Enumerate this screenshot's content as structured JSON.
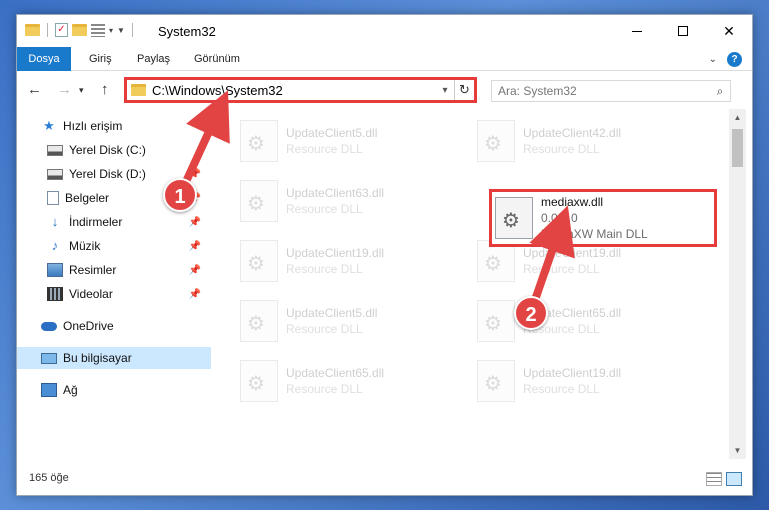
{
  "window": {
    "title": "System32",
    "minimize_icon": "minimize-icon",
    "maximize_icon": "maximize-icon",
    "close_symbol": "✕"
  },
  "ribbon": {
    "tabs": [
      "Dosya",
      "Giriş",
      "Paylaş",
      "Görünüm"
    ],
    "help_symbol": "?",
    "expand_symbol": "⌄"
  },
  "address": {
    "path": "C:\\Windows\\System32",
    "search_placeholder": "Ara: System32"
  },
  "nav": {
    "quick_access": "Hızlı erişim",
    "items": [
      {
        "label": "Yerel Disk (C:)",
        "pinned": true
      },
      {
        "label": "Yerel Disk (D:)",
        "pinned": true
      },
      {
        "label": "Belgeler",
        "pinned": true
      },
      {
        "label": "İndirmeler",
        "pinned": true
      },
      {
        "label": "Müzik",
        "pinned": true
      },
      {
        "label": "Resimler",
        "pinned": true
      },
      {
        "label": "Videolar",
        "pinned": true
      }
    ],
    "onedrive": "OneDrive",
    "this_pc": "Bu bilgisayar",
    "network": "Ağ"
  },
  "files": {
    "left_column": [
      {
        "name": "UpdateClient5.dll",
        "type": "Resource DLL"
      },
      {
        "name": "UpdateClient63.dll",
        "type": "Resource DLL"
      },
      {
        "name": "UpdateClient19.dll",
        "type": "Resource DLL"
      },
      {
        "name": "UpdateClient5.dll",
        "type": "Resource DLL"
      },
      {
        "name": "UpdateClient65.dll",
        "type": "Resource DLL"
      }
    ],
    "right_column": [
      {
        "name": "UpdateClient42.dll",
        "type": "Resource DLL"
      },
      {
        "name": "UpdateClient19.dll",
        "type": "Resource DLL"
      },
      {
        "name": "UpdateClient65.dll",
        "type": "Resource DLL"
      },
      {
        "name": "UpdateClient19.dll",
        "type": "Resource DLL"
      }
    ],
    "highlighted": {
      "name": "mediaxw.dll",
      "version": "0.0.6.0",
      "description": "MediaXW Main DLL"
    }
  },
  "status": {
    "item_count": "165 öğe"
  },
  "annotations": {
    "step1": "1",
    "step2": "2",
    "color": "#e53b3b"
  }
}
